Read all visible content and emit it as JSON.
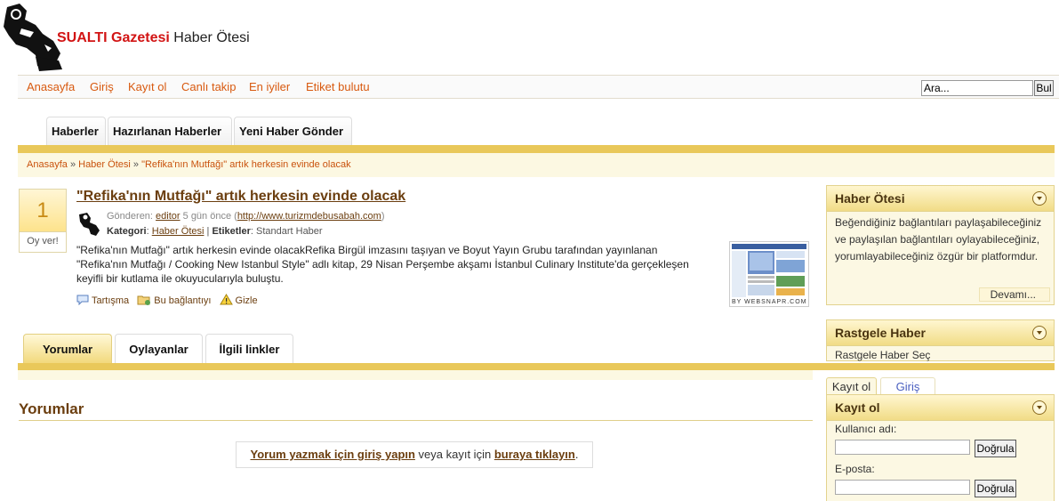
{
  "header": {
    "logo_icon": "scuba-diver-icon",
    "title_brand": "SUALTI Gazetesi",
    "title_rest": "Haber Ötesi"
  },
  "nav": {
    "items": [
      "Anasayfa",
      "Giriş",
      "Kayıt ol",
      "Canlı takip",
      "En iyiler",
      "Etiket bulutu"
    ]
  },
  "search": {
    "value": "Ara...",
    "button": "Bul"
  },
  "main_tabs": [
    "Haberler",
    "Hazırlanan Haberler",
    "Yeni Haber Gönder"
  ],
  "breadcrumb": {
    "home": "Anasayfa",
    "section": "Haber Ötesi",
    "current": "\"Refika'nın Mutfağı\" artık herkesin evinde olacak",
    "separator": "»"
  },
  "story": {
    "votes": "1",
    "vote_label": "Oy ver!",
    "title": "\"Refika'nın Mutfağı\" artık herkesin evinde olacak",
    "submitted_label": "Gönderen:",
    "author": "editor",
    "time": "5 gün önce",
    "source_url": "http://www.turizmdebusabah.com",
    "category_label": "Kategori",
    "category": "Haber Ötesi",
    "tags_label": "Etiketler",
    "tags": "Standart Haber",
    "body": "\"Refika'nın Mutfağı\" artık herkesin evinde olacakRefika Birgül imzasını taşıyan ve Boyut Yayın Grubu tarafından yayınlanan \"Refika'nın Mutfağı / Cooking New Istanbul Style\" adlı kitap, 29 Nisan Perşembe akşamı İstanbul Culinary Institute'da gerçekleşen keyifli bir kutlama ile okuyucularıyla buluştu.",
    "actions": {
      "discuss": "Tartışma",
      "save": "Bu bağlantıyı",
      "hide": "Gizle"
    },
    "thumbnail_caption": "BY WEBSNAPR.COM"
  },
  "comment_tabs": [
    "Yorumlar",
    "Oylayanlar",
    "İlgili linkler"
  ],
  "comments": {
    "title": "Yorumlar",
    "login_link": "Yorum yazmak için giriş yapın",
    "middle": " veya kayıt için ",
    "register_link": "buraya tıklayın",
    "end": "."
  },
  "sidebar": {
    "about": {
      "title": "Haber Ötesi",
      "text": "Beğendiğiniz bağlantıları paylaşabileceğiniz ve paylaşılan bağlantıları oylayabileceğiniz, yorumlayabileceğiniz özgür bir platformdur.",
      "more": "Devamı..."
    },
    "random": {
      "title": "Rastgele Haber",
      "link": "Rastgele Haber Seç"
    },
    "auth_tabs": [
      "Kayıt ol",
      "Giriş"
    ],
    "register": {
      "title": "Kayıt ol",
      "username_label": "Kullanıcı adı:",
      "email_label": "E-posta:",
      "verify_button": "Doğrula"
    }
  },
  "colors": {
    "accent_gold": "#e9c85a",
    "nav_orange": "#d85a10",
    "link_brown": "#6b3e0f",
    "brand_red": "#d21414"
  }
}
